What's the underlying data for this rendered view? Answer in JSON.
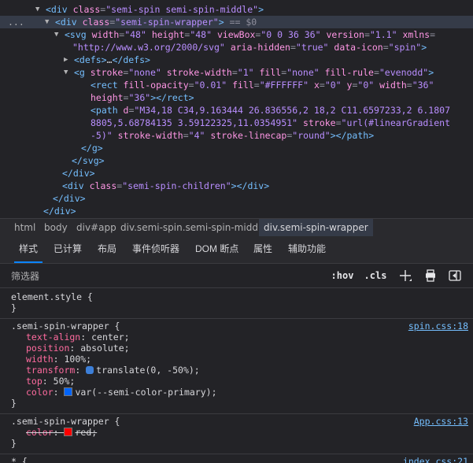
{
  "dom": {
    "lines": [
      {
        "indent": 58,
        "arrow": "down",
        "parts": [
          [
            "tag",
            "<div "
          ],
          [
            "attr",
            "class"
          ],
          [
            "eq",
            "="
          ],
          [
            "val",
            "\"semi-spin semi-spin-middle\""
          ],
          [
            "tag",
            ">"
          ]
        ]
      },
      {
        "indent": 70,
        "arrow": "down",
        "selected": true,
        "parts": [
          [
            "tag",
            "<div "
          ],
          [
            "attr",
            "class"
          ],
          [
            "eq",
            "="
          ],
          [
            "val",
            "\"semi-spin-wrapper\""
          ],
          [
            "tag",
            ">"
          ],
          [
            "dimmed",
            " == $0"
          ]
        ]
      },
      {
        "indent": 82,
        "arrow": "down",
        "parts": [
          [
            "tag",
            "<svg "
          ],
          [
            "attr",
            "width"
          ],
          [
            "eq",
            "="
          ],
          [
            "val",
            "\"48\""
          ],
          [
            "txt",
            " "
          ],
          [
            "attr",
            "height"
          ],
          [
            "eq",
            "="
          ],
          [
            "val",
            "\"48\""
          ],
          [
            "txt",
            " "
          ],
          [
            "attr",
            "viewBox"
          ],
          [
            "eq",
            "="
          ],
          [
            "val",
            "\"0 0 36 36\""
          ],
          [
            "txt",
            " "
          ],
          [
            "attr",
            "version"
          ],
          [
            "eq",
            "="
          ],
          [
            "val",
            "\"1.1\""
          ],
          [
            "txt",
            " "
          ],
          [
            "attr",
            "xmlns"
          ],
          [
            "eq",
            "="
          ]
        ]
      },
      {
        "indent": 92,
        "parts": [
          [
            "val",
            "\"http://www.w3.org/2000/svg\""
          ],
          [
            "txt",
            " "
          ],
          [
            "attr",
            "aria-hidden"
          ],
          [
            "eq",
            "="
          ],
          [
            "val",
            "\"true\""
          ],
          [
            "txt",
            " "
          ],
          [
            "attr",
            "data-icon"
          ],
          [
            "eq",
            "="
          ],
          [
            "val",
            "\"spin\""
          ],
          [
            "tag",
            ">"
          ]
        ]
      },
      {
        "indent": 94,
        "arrow": "right",
        "parts": [
          [
            "tag",
            "<defs>"
          ],
          [
            "txt",
            "…"
          ],
          [
            "tag",
            "</defs>"
          ]
        ]
      },
      {
        "indent": 94,
        "arrow": "down",
        "parts": [
          [
            "tag",
            "<g "
          ],
          [
            "attr",
            "stroke"
          ],
          [
            "eq",
            "="
          ],
          [
            "val",
            "\"none\""
          ],
          [
            "txt",
            " "
          ],
          [
            "attr",
            "stroke-width"
          ],
          [
            "eq",
            "="
          ],
          [
            "val",
            "\"1\""
          ],
          [
            "txt",
            " "
          ],
          [
            "attr",
            "fill"
          ],
          [
            "eq",
            "="
          ],
          [
            "val",
            "\"none\""
          ],
          [
            "txt",
            " "
          ],
          [
            "attr",
            "fill-rule"
          ],
          [
            "eq",
            "="
          ],
          [
            "val",
            "\"evenodd\""
          ],
          [
            "tag",
            ">"
          ]
        ]
      },
      {
        "indent": 115,
        "parts": [
          [
            "tag",
            "<rect "
          ],
          [
            "attr",
            "fill-opacity"
          ],
          [
            "eq",
            "="
          ],
          [
            "val",
            "\"0.01\""
          ],
          [
            "txt",
            " "
          ],
          [
            "attr",
            "fill"
          ],
          [
            "eq",
            "="
          ],
          [
            "val",
            "\"#FFFFFF\""
          ],
          [
            "txt",
            " "
          ],
          [
            "attr",
            "x"
          ],
          [
            "eq",
            "="
          ],
          [
            "val",
            "\"0\""
          ],
          [
            "txt",
            " "
          ],
          [
            "attr",
            "y"
          ],
          [
            "eq",
            "="
          ],
          [
            "val",
            "\"0\""
          ],
          [
            "txt",
            " "
          ],
          [
            "attr",
            "width"
          ],
          [
            "eq",
            "="
          ],
          [
            "val",
            "\"36\""
          ]
        ]
      },
      {
        "indent": 115,
        "parts": [
          [
            "attr",
            "height"
          ],
          [
            "eq",
            "="
          ],
          [
            "val",
            "\"36\""
          ],
          [
            "tag",
            "></rect>"
          ]
        ]
      },
      {
        "indent": 115,
        "parts": [
          [
            "tag",
            "<path "
          ],
          [
            "attr",
            "d"
          ],
          [
            "eq",
            "="
          ],
          [
            "val",
            "\"M34,18 C34,9.163444 26.836556,2 18,2 C11.6597233,2 6.1807"
          ]
        ]
      },
      {
        "indent": 115,
        "parts": [
          [
            "val",
            "8805,5.68784135 3.59122325,11.0354951\""
          ],
          [
            "txt",
            " "
          ],
          [
            "attr",
            "stroke"
          ],
          [
            "eq",
            "="
          ],
          [
            "val",
            "\"url(#linearGradient"
          ]
        ]
      },
      {
        "indent": 115,
        "parts": [
          [
            "val",
            "-5)\""
          ],
          [
            "txt",
            " "
          ],
          [
            "attr",
            "stroke-width"
          ],
          [
            "eq",
            "="
          ],
          [
            "val",
            "\"4\""
          ],
          [
            "txt",
            " "
          ],
          [
            "attr",
            "stroke-linecap"
          ],
          [
            "eq",
            "="
          ],
          [
            "val",
            "\"round\""
          ],
          [
            "tag",
            "></path>"
          ]
        ]
      },
      {
        "indent": 103,
        "parts": [
          [
            "tag",
            "</g>"
          ]
        ]
      },
      {
        "indent": 91,
        "parts": [
          [
            "tag",
            "</svg>"
          ]
        ]
      },
      {
        "indent": 79,
        "parts": [
          [
            "tag",
            "</div>"
          ]
        ]
      },
      {
        "indent": 79,
        "parts": [
          [
            "tag",
            "<div "
          ],
          [
            "attr",
            "class"
          ],
          [
            "eq",
            "="
          ],
          [
            "val",
            "\"semi-spin-children\""
          ],
          [
            "tag",
            "></div>"
          ]
        ]
      },
      {
        "indent": 67,
        "parts": [
          [
            "tag",
            "</div>"
          ]
        ]
      },
      {
        "indent": 55,
        "parts": [
          [
            "tag",
            "</div>"
          ]
        ]
      }
    ],
    "selected_prefix": "..."
  },
  "breadcrumbs": [
    {
      "label": "html"
    },
    {
      "label": "body"
    },
    {
      "label": "div#app"
    },
    {
      "label": "div.semi-spin.semi-spin-middle"
    },
    {
      "label": "div.semi-spin-wrapper",
      "active": true
    }
  ],
  "tabs": [
    {
      "label": "样式",
      "active": true
    },
    {
      "label": "已计算"
    },
    {
      "label": "布局"
    },
    {
      "label": "事件侦听器"
    },
    {
      "label": "DOM 断点"
    },
    {
      "label": "属性"
    },
    {
      "label": "辅助功能"
    }
  ],
  "filter": {
    "placeholder": "筛选器",
    "hov": ":hov",
    "cls": ".cls"
  },
  "rules": [
    {
      "selector": "element.style {",
      "source": "",
      "decls": [],
      "close": "}"
    },
    {
      "selector": ".semi-spin-wrapper {",
      "source": "spin.css:18",
      "close": "}",
      "decls": [
        {
          "prop": "text-align",
          "value": "center;"
        },
        {
          "prop": "position",
          "value": "absolute;"
        },
        {
          "prop": "width",
          "value": "100%;"
        },
        {
          "prop": "transform",
          "value": "translate(0, -50%);",
          "icon": true
        },
        {
          "prop": "top",
          "value": "50%;"
        },
        {
          "prop": "color",
          "value": "var(--semi-color-primary);",
          "swatch": "#0064fa"
        }
      ]
    },
    {
      "selector": ".semi-spin-wrapper {",
      "source": "App.css:13",
      "close": "}",
      "decls": [
        {
          "prop": "color",
          "value": "red;",
          "swatch": "#ff0000",
          "struck": true
        }
      ]
    },
    {
      "selector": "* {",
      "source": "index.css:21",
      "close": "",
      "decls": []
    }
  ],
  "colors": {
    "accent": "#0a84ff",
    "selected_row": "#353b48"
  }
}
